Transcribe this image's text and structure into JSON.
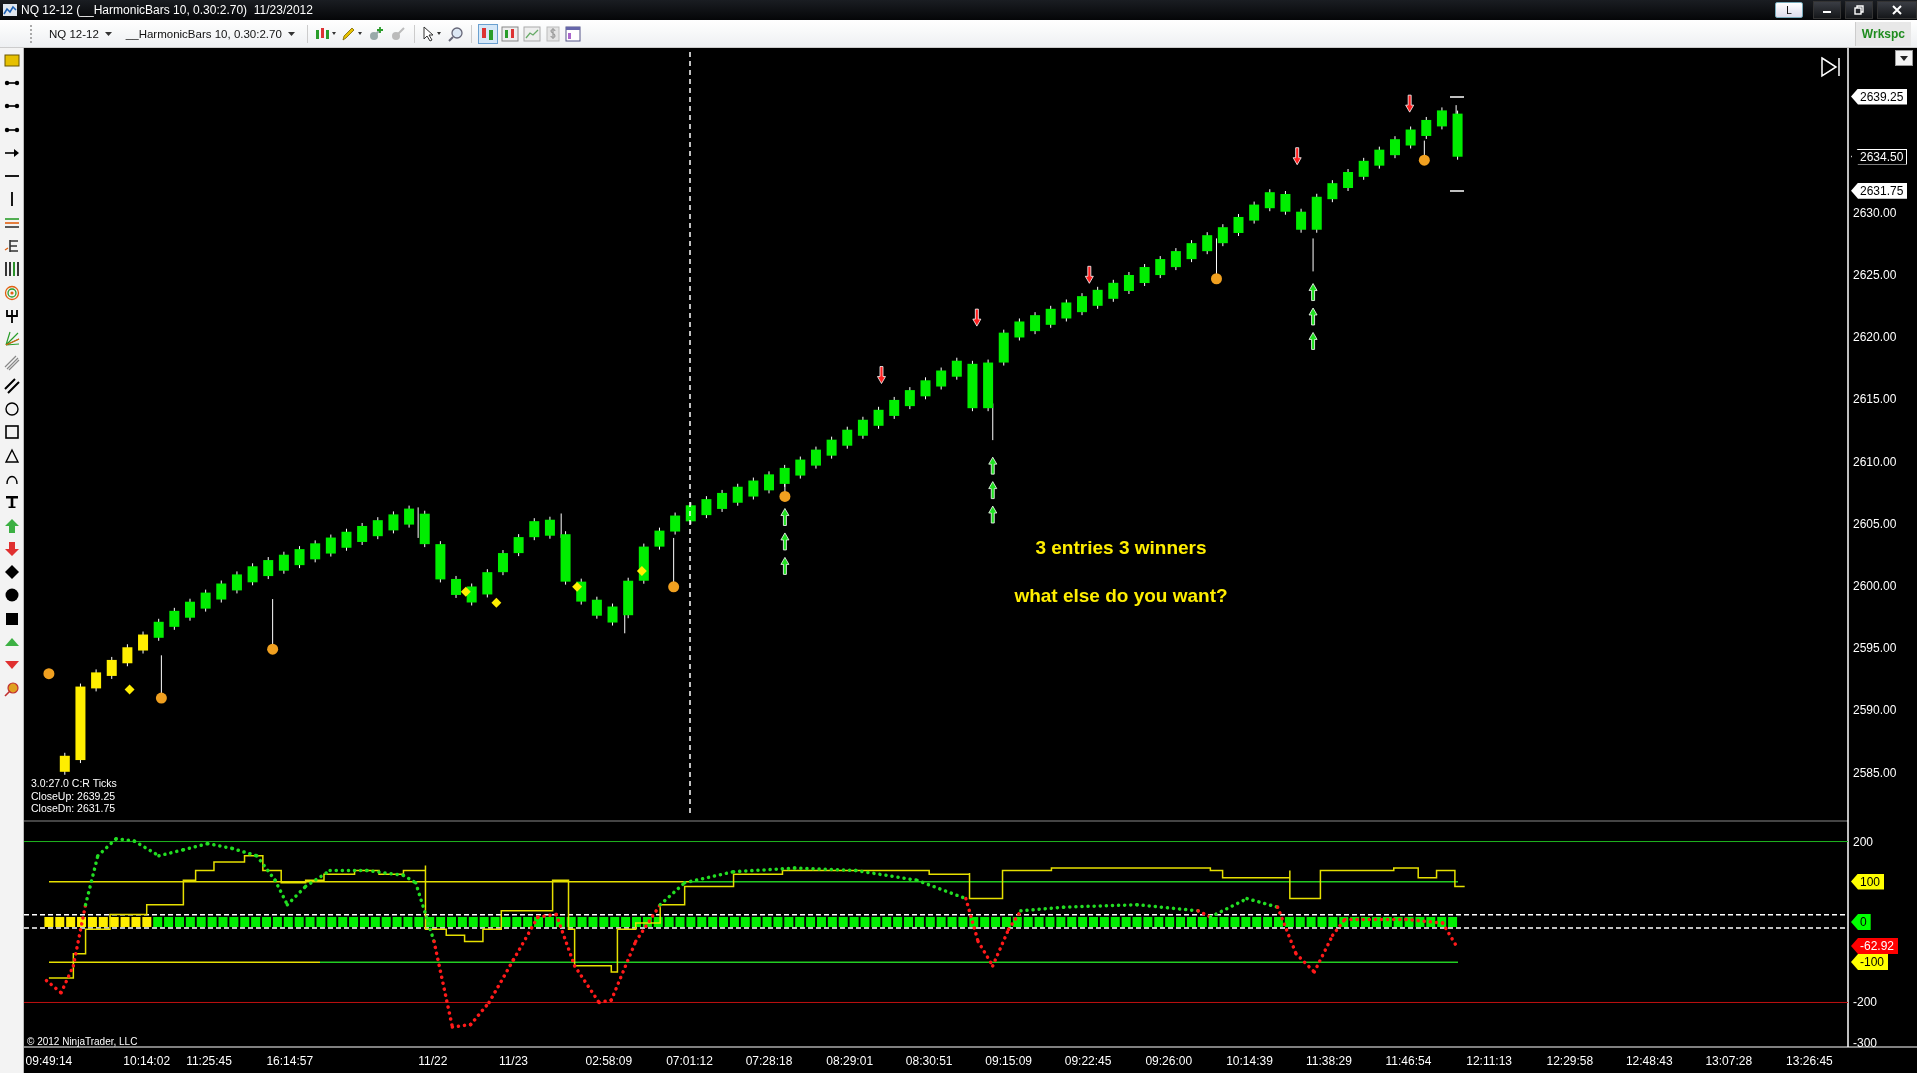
{
  "window": {
    "title": "NQ 12-12 (__HarmonicBars 10, 0.30:2.70)  11/23/2012",
    "layout_button": "L"
  },
  "toolbar": {
    "instrument": "NQ 12-12",
    "bar_type": "__HarmonicBars 10, 0.30:2.70",
    "workspace": "Wrkspc"
  },
  "price_panel": {
    "info_lines": [
      "3.0:27.0 C:R Ticks",
      "CloseUp: 2639.25",
      "CloseDn: 2631.75"
    ],
    "overlay_texts": [
      "3 entries 3 winners",
      "what else do you want?"
    ],
    "ticks": [
      "2630.00",
      "2625.00",
      "2620.00",
      "2615.00",
      "2610.00",
      "2605.00",
      "2600.00",
      "2595.00",
      "2590.00",
      "2585.00"
    ],
    "tags": [
      {
        "label": "2639.25",
        "kind": "close-up"
      },
      {
        "label": "2634.50",
        "kind": "last"
      },
      {
        "label": "2631.75",
        "kind": "close-down"
      }
    ]
  },
  "indicator_panel": {
    "copyright": "© 2012 NinjaTrader, LLC",
    "ticks": [
      "200",
      "-200",
      "-300"
    ],
    "tags": [
      {
        "label": "100",
        "color": "#ffff00"
      },
      {
        "label": "0",
        "color": "#00ff00"
      },
      {
        "label": "-62.92",
        "color": "#ff0000"
      },
      {
        "label": "-100",
        "color": "#ffff00"
      }
    ]
  },
  "time_axis": [
    "09:49:14",
    "10:14:02",
    "11:25:45",
    "16:14:57",
    "11/22",
    "11/23",
    "02:58:09",
    "07:01:12",
    "07:28:18",
    "08:29:01",
    "08:30:51",
    "09:15:09",
    "09:22:45",
    "09:26:00",
    "10:14:39",
    "11:38:29",
    "11:46:54",
    "12:11:13",
    "12:29:58",
    "12:48:43",
    "13:07:28",
    "13:26:45"
  ]
}
